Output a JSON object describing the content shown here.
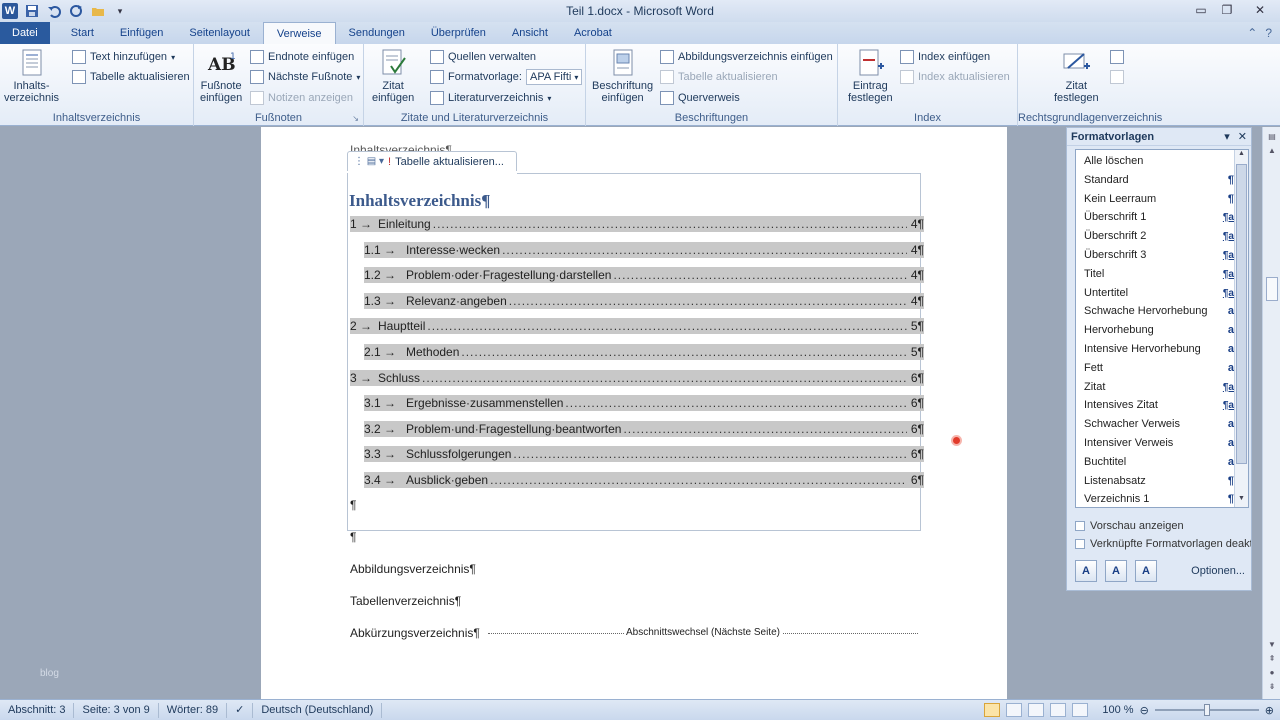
{
  "window": {
    "title": "Teil 1.docx - Microsoft Word"
  },
  "tabs": [
    "Datei",
    "Start",
    "Einfügen",
    "Seitenlayout",
    "Verweise",
    "Sendungen",
    "Überprüfen",
    "Ansicht",
    "Acrobat"
  ],
  "active_tab": "Verweise",
  "ribbon": {
    "toc": {
      "big_label1": "Inhalts-",
      "big_label2": "verzeichnis",
      "add_text": "Text hinzufügen",
      "update_table": "Tabelle aktualisieren",
      "group": "Inhaltsverzeichnis"
    },
    "footnotes": {
      "big_label1": "Fußnote",
      "big_label2": "einfügen",
      "insert_endnote": "Endnote einfügen",
      "next_footnote": "Nächste Fußnote",
      "show_notes": "Notizen anzeigen",
      "group": "Fußnoten"
    },
    "citations": {
      "big_label1": "Zitat",
      "big_label2": "einfügen",
      "manage_sources": "Quellen verwalten",
      "style_label": "Formatvorlage:",
      "style_value": "APA Fifti",
      "bibliography": "Literaturverzeichnis",
      "group": "Zitate und Literaturverzeichnis"
    },
    "captions": {
      "big_label1": "Beschriftung",
      "big_label2": "einfügen",
      "insert_figures": "Abbildungsverzeichnis einfügen",
      "update_table": "Tabelle aktualisieren",
      "cross_ref": "Querverweis",
      "group": "Beschriftungen"
    },
    "index": {
      "big_label1": "Eintrag",
      "big_label2": "festlegen",
      "insert_index": "Index einfügen",
      "update_index": "Index aktualisieren",
      "group": "Index"
    },
    "authorities": {
      "big_label1": "Zitat",
      "big_label2": "festlegen",
      "group": "Rechtsgrundlagenverzeichnis"
    }
  },
  "document": {
    "top_para": "Inhaltsverzeichnis¶",
    "toc_control_label": "Tabelle aktualisieren...",
    "toc_title": "Inhaltsverzeichnis¶",
    "toc_entries": [
      {
        "num": "1 →",
        "text": "Einleitung",
        "page": "4¶",
        "level": 1
      },
      {
        "num": "1.1 →",
        "text": "Interesse·wecken",
        "page": "4¶",
        "level": 2
      },
      {
        "num": "1.2 →",
        "text": "Problem·oder·Fragestellung·darstellen",
        "page": "4¶",
        "level": 2
      },
      {
        "num": "1.3 →",
        "text": "Relevanz·angeben",
        "page": "4¶",
        "level": 2
      },
      {
        "num": "2 →",
        "text": "Hauptteil",
        "page": "5¶",
        "level": 1
      },
      {
        "num": "2.1 →",
        "text": "Methoden",
        "page": "5¶",
        "level": 2
      },
      {
        "num": "3 →",
        "text": "Schluss",
        "page": "6¶",
        "level": 1
      },
      {
        "num": "3.1 →",
        "text": "Ergebnisse·zusammenstellen",
        "page": "6¶",
        "level": 2
      },
      {
        "num": "3.2 →",
        "text": "Problem·und·Fragestellung·beantworten",
        "page": "6¶",
        "level": 2
      },
      {
        "num": "3.3 →",
        "text": "Schlussfolgerungen",
        "page": "6¶",
        "level": 2
      },
      {
        "num": "3.4 →",
        "text": "Ausblick·geben",
        "page": "6¶",
        "level": 2
      }
    ],
    "empty_para": "¶",
    "figures": "Abbildungsverzeichnis¶",
    "tables": "Tabellenverzeichnis¶",
    "abbreviations": "Abkürzungsverzeichnis¶",
    "section_break": "Abschnittswechsel (Nächste Seite)"
  },
  "styles_pane": {
    "title": "Formatvorlagen",
    "items": [
      {
        "name": "Alle löschen",
        "mark": ""
      },
      {
        "name": "Standard",
        "mark": "¶"
      },
      {
        "name": "Kein Leerraum",
        "mark": "¶"
      },
      {
        "name": "Überschrift 1",
        "mark": "¶a"
      },
      {
        "name": "Überschrift 2",
        "mark": "¶a"
      },
      {
        "name": "Überschrift 3",
        "mark": "¶a"
      },
      {
        "name": "Titel",
        "mark": "¶a"
      },
      {
        "name": "Untertitel",
        "mark": "¶a"
      },
      {
        "name": "Schwache Hervorhebung",
        "mark": "a"
      },
      {
        "name": "Hervorhebung",
        "mark": "a"
      },
      {
        "name": "Intensive Hervorhebung",
        "mark": "a"
      },
      {
        "name": "Fett",
        "mark": "a"
      },
      {
        "name": "Zitat",
        "mark": "¶a"
      },
      {
        "name": "Intensives Zitat",
        "mark": "¶a"
      },
      {
        "name": "Schwacher Verweis",
        "mark": "a"
      },
      {
        "name": "Intensiver Verweis",
        "mark": "a"
      },
      {
        "name": "Buchtitel",
        "mark": "a"
      },
      {
        "name": "Listenabsatz",
        "mark": "¶"
      },
      {
        "name": "Verzeichnis 1",
        "mark": "¶"
      }
    ],
    "preview": "Vorschau anzeigen",
    "linked": "Verknüpfte Formatvorlagen deaktivieren",
    "options": "Optionen..."
  },
  "watermark": "blog",
  "statusbar": {
    "section": "Abschnitt: 3",
    "page": "Seite: 3 von 9",
    "words": "Wörter: 89",
    "language": "Deutsch (Deutschland)",
    "zoom": "100 %",
    "zoom_level": 0.5
  }
}
